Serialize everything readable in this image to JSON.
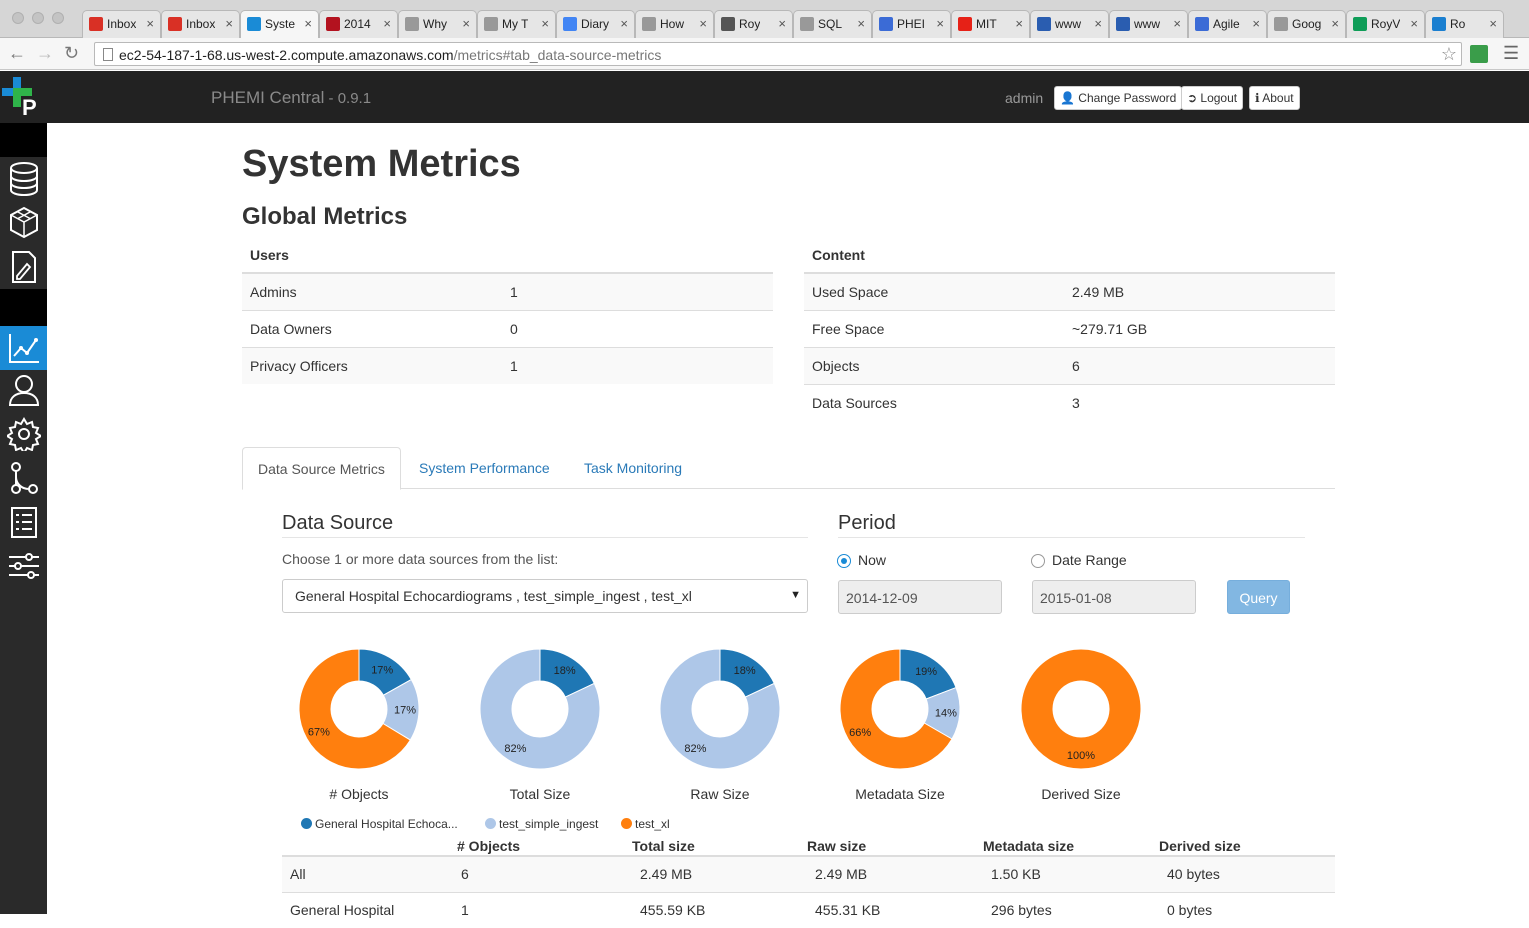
{
  "browser": {
    "tabs": [
      {
        "label": "Inbox",
        "icon": "gmail-icon",
        "color": "#d93025"
      },
      {
        "label": "Inbox",
        "icon": "gmail-icon",
        "color": "#d93025"
      },
      {
        "label": "Syste",
        "icon": "phemi-icon",
        "color": "#1a8bd6"
      },
      {
        "label": "2014",
        "icon": "red-b-icon",
        "color": "#b3121f"
      },
      {
        "label": "Why",
        "icon": "page-icon",
        "color": "#999999"
      },
      {
        "label": "My T",
        "icon": "page-icon",
        "color": "#999999"
      },
      {
        "label": "Diary",
        "icon": "docs-icon",
        "color": "#4285f4"
      },
      {
        "label": "How",
        "icon": "page-icon",
        "color": "#999999"
      },
      {
        "label": "Roy",
        "icon": "s-icon",
        "color": "#555555"
      },
      {
        "label": "SQL",
        "icon": "page-icon",
        "color": "#999999"
      },
      {
        "label": "PHEI",
        "icon": "calendar-icon",
        "color": "#3b6bd6"
      },
      {
        "label": "MIT",
        "icon": "youtube-icon",
        "color": "#e62117"
      },
      {
        "label": "www",
        "icon": "bars-icon",
        "color": "#2a5db0"
      },
      {
        "label": "www",
        "icon": "bars-icon",
        "color": "#2a5db0"
      },
      {
        "label": "Agile",
        "icon": "agile-icon",
        "color": "#3b6bd6"
      },
      {
        "label": "Goog",
        "icon": "page-icon",
        "color": "#999999"
      },
      {
        "label": "RoyV",
        "icon": "sheets-icon",
        "color": "#0f9d58"
      },
      {
        "label": "Ro",
        "icon": "audio-icon",
        "color": "#1a7fd0"
      }
    ],
    "url_host": "ec2-54-187-1-68.us-west-2.compute.amazonaws.com",
    "url_path": "/metrics#tab_data-source-metrics"
  },
  "header": {
    "app_name": "PHEMI Central",
    "version": " - 0.9.1",
    "user": "admin",
    "change_password": "Change Password",
    "logout": "Logout",
    "about": "About"
  },
  "page": {
    "title": "System Metrics",
    "global_title": "Global Metrics"
  },
  "users_table": {
    "header": "Users",
    "rows": [
      {
        "label": "Admins",
        "value": "1"
      },
      {
        "label": "Data Owners",
        "value": "0"
      },
      {
        "label": "Privacy Officers",
        "value": "1"
      }
    ]
  },
  "content_table": {
    "header": "Content",
    "rows": [
      {
        "label": "Used Space",
        "value": "2.49 MB"
      },
      {
        "label": "Free Space",
        "value": "~279.71 GB"
      },
      {
        "label": "Objects",
        "value": "6"
      },
      {
        "label": "Data Sources",
        "value": "3"
      }
    ]
  },
  "tabs": [
    "Data Source Metrics",
    "System Performance",
    "Task Monitoring"
  ],
  "data_source": {
    "title": "Data Source",
    "help": "Choose 1 or more data sources from the list:",
    "selected": "General Hospital Echocardiograms , test_simple_ingest , test_xl"
  },
  "period": {
    "title": "Period",
    "now_label": "Now",
    "range_label": "Date Range",
    "selected": "Now",
    "start_date": "2014-12-09",
    "end_date": "2015-01-08",
    "query_label": "Query"
  },
  "colors": {
    "series_1": "#1f77b4",
    "series_2": "#aec7e8",
    "series_3": "#ff7f0e",
    "accent": "#1a8bd6"
  },
  "chart_data": [
    {
      "type": "pie",
      "title": "# Objects",
      "series": [
        "General Hospital Echoca...",
        "test_simple_ingest",
        "test_xl"
      ],
      "values": [
        17,
        17,
        67
      ],
      "labels": [
        "17%",
        "17%",
        "67%"
      ]
    },
    {
      "type": "pie",
      "title": "Total Size",
      "series": [
        "General Hospital Echoca...",
        "test_simple_ingest",
        "test_xl"
      ],
      "values": [
        18,
        82,
        0
      ],
      "labels": [
        "18%",
        "82%",
        ""
      ]
    },
    {
      "type": "pie",
      "title": "Raw Size",
      "series": [
        "General Hospital Echoca...",
        "test_simple_ingest",
        "test_xl"
      ],
      "values": [
        18,
        82,
        0
      ],
      "labels": [
        "18%",
        "82%",
        ""
      ]
    },
    {
      "type": "pie",
      "title": "Metadata Size",
      "series": [
        "General Hospital Echoca...",
        "test_simple_ingest",
        "test_xl"
      ],
      "values": [
        19,
        14,
        66
      ],
      "labels": [
        "19%",
        "14%",
        "66%"
      ]
    },
    {
      "type": "pie",
      "title": "Derived Size",
      "series": [
        "General Hospital Echoca...",
        "test_simple_ingest",
        "test_xl"
      ],
      "values": [
        0,
        0,
        100
      ],
      "labels": [
        "",
        "",
        "100%"
      ]
    }
  ],
  "legend": [
    "General Hospital Echoca...",
    "test_simple_ingest",
    "test_xl"
  ],
  "metrics_table": {
    "columns": [
      "",
      "# Objects",
      "Total size",
      "Raw size",
      "Metadata size",
      "Derived size"
    ],
    "rows": [
      [
        "All",
        "6",
        "2.49 MB",
        "2.49 MB",
        "1.50 KB",
        "40 bytes"
      ],
      [
        "General Hospital",
        "1",
        "455.59 KB",
        "455.31 KB",
        "296 bytes",
        "0 bytes"
      ]
    ]
  }
}
